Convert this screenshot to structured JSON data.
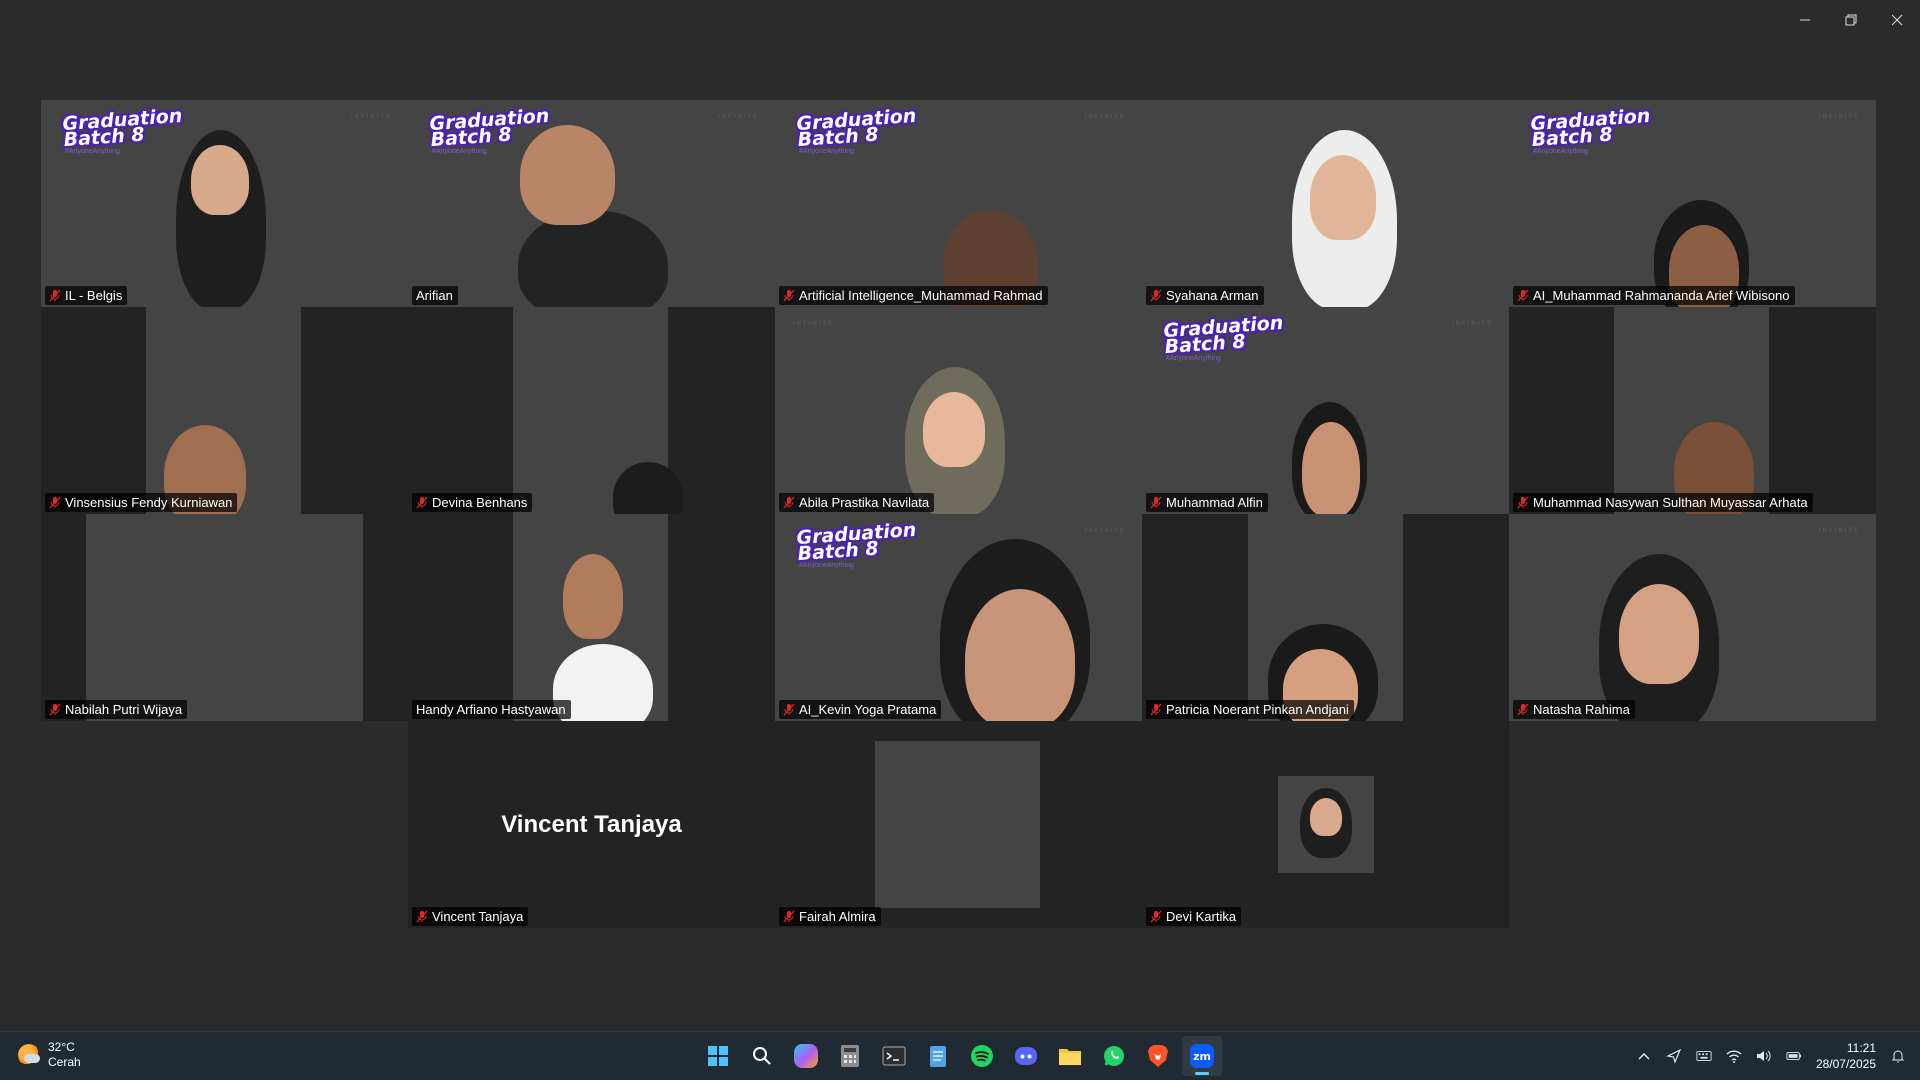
{
  "window": {
    "controls": [
      "minimize",
      "restore",
      "close"
    ]
  },
  "banner": {
    "title_line1": "Graduation",
    "title_line2": "Batch 8",
    "hashtag": "#AnyoneAnything",
    "corner": "INFINITE"
  },
  "participants": [
    {
      "name": "IL - Belgis",
      "muted": true,
      "active": false
    },
    {
      "name": "Arifian",
      "muted": false,
      "active": true
    },
    {
      "name": "Artificial Intelligence_Muhammad Rahmad",
      "muted": true,
      "active": false
    },
    {
      "name": "Syahana Arman",
      "muted": true,
      "active": false
    },
    {
      "name": "AI_Muhammad Rahmananda Arief Wibisono",
      "muted": true,
      "active": false
    },
    {
      "name": "Vinsensius Fendy Kurniawan",
      "muted": true,
      "active": false
    },
    {
      "name": "Devina Benhans",
      "muted": true,
      "active": false
    },
    {
      "name": "Abila Prastika Navilata",
      "muted": true,
      "active": false
    },
    {
      "name": "Muhammad Alfin",
      "muted": true,
      "active": false
    },
    {
      "name": "Muhammad Nasywan Sulthan Muyassar Arhata",
      "muted": true,
      "active": false
    },
    {
      "name": "Nabilah Putri Wijaya",
      "muted": true,
      "active": false
    },
    {
      "name": "Handy Arfiano Hastyawan",
      "muted": false,
      "active": false
    },
    {
      "name": "AI_Kevin Yoga Pratama",
      "muted": true,
      "active": false
    },
    {
      "name": "Patricia Noerant Pinkan Andjani",
      "muted": true,
      "active": false
    },
    {
      "name": "Natasha Rahima",
      "muted": true,
      "active": false
    },
    {
      "name": "Vincent Tanjaya",
      "muted": true,
      "active": false,
      "video_off": true
    },
    {
      "name": "Fairah Almira",
      "muted": true,
      "active": false
    },
    {
      "name": "Devi Kartika",
      "muted": true,
      "active": false
    }
  ],
  "taskbar": {
    "weather": {
      "temp": "32°C",
      "condition": "Cerah"
    },
    "apps": [
      {
        "icon": "windows-start-icon"
      },
      {
        "icon": "search-icon"
      },
      {
        "icon": "copilot-icon"
      },
      {
        "icon": "calculator-icon"
      },
      {
        "icon": "terminal-icon"
      },
      {
        "icon": "notepad-icon"
      },
      {
        "icon": "spotify-icon"
      },
      {
        "icon": "discord-icon"
      },
      {
        "icon": "file-explorer-icon"
      },
      {
        "icon": "whatsapp-icon"
      },
      {
        "icon": "brave-icon"
      },
      {
        "icon": "zoom-icon",
        "label": "zm",
        "active": true
      }
    ],
    "clock": {
      "time": "11:21",
      "date": "28/07/2025"
    }
  }
}
